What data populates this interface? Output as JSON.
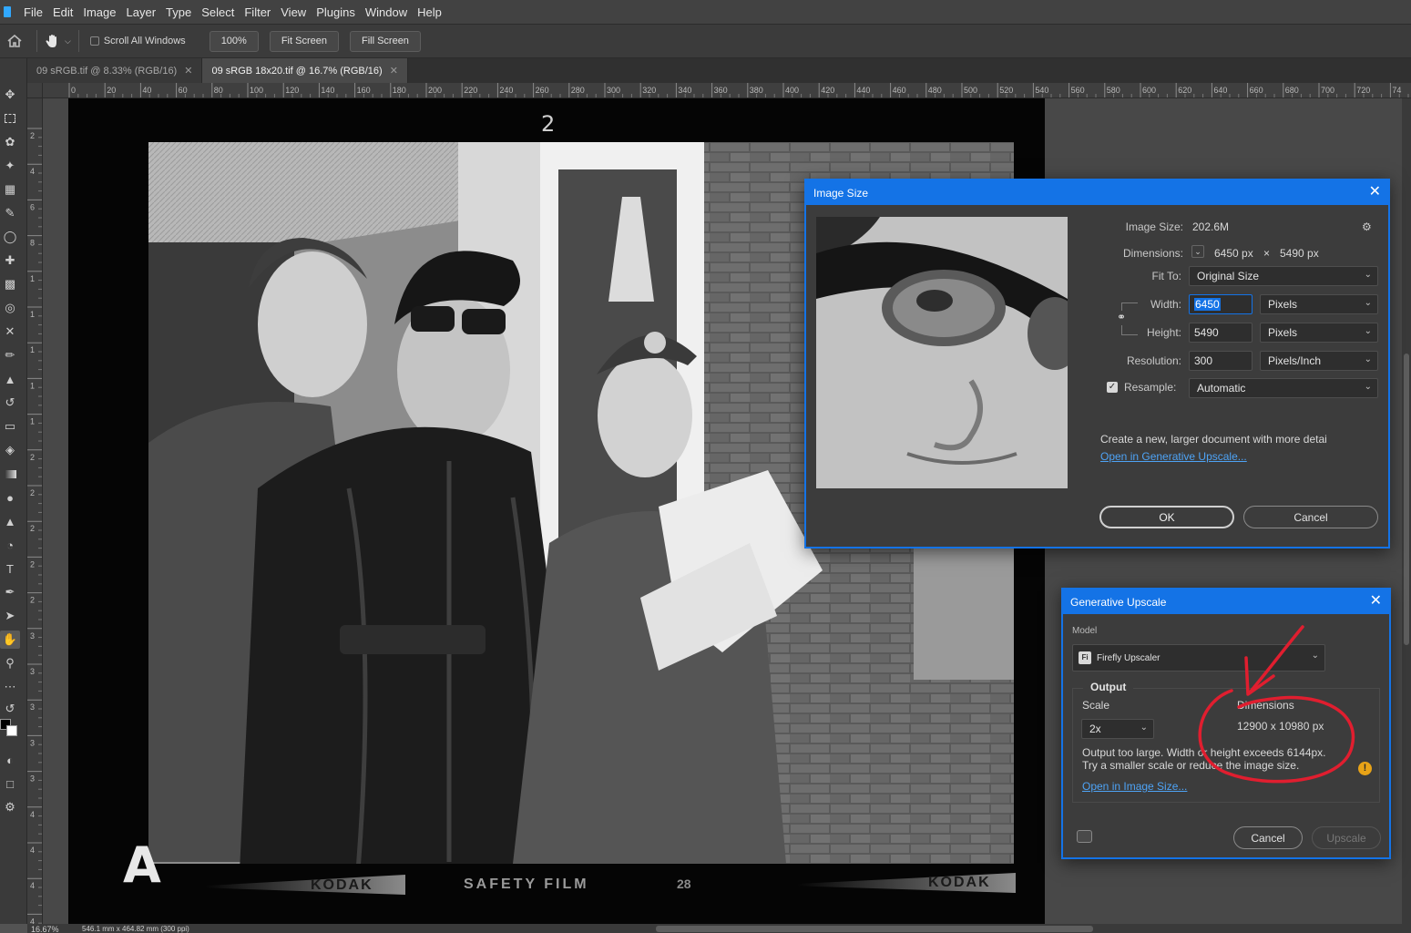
{
  "menu": [
    "File",
    "Edit",
    "Image",
    "Layer",
    "Type",
    "Select",
    "Filter",
    "View",
    "Plugins",
    "Window",
    "Help"
  ],
  "options_bar": {
    "scroll_all_windows": "Scroll All Windows",
    "zoom_btn": "100%",
    "fit_screen": "Fit Screen",
    "fill_screen": "Fill Screen"
  },
  "tabs": [
    {
      "label": "09 sRGB.tif @ 8.33% (RGB/16)"
    },
    {
      "label": "09 sRGB 18x20.tif @ 16.7% (RGB/16)"
    }
  ],
  "ruler_h": [
    "0",
    "20",
    "40",
    "60",
    "80",
    "100",
    "120",
    "140",
    "160",
    "180",
    "200",
    "220",
    "240",
    "260",
    "280",
    "300",
    "320",
    "340",
    "360",
    "380",
    "400",
    "420",
    "440",
    "460",
    "480",
    "500",
    "520",
    "540",
    "560",
    "580",
    "600",
    "620",
    "640",
    "660",
    "680",
    "700",
    "720",
    "74"
  ],
  "ruler_v": [
    "2",
    "4",
    "6",
    "8",
    "1",
    "1",
    "1",
    "1",
    "1",
    "2",
    "2",
    "2",
    "2",
    "2",
    "3",
    "3",
    "3",
    "3",
    "3",
    "4",
    "4",
    "4",
    "4",
    "4"
  ],
  "film": {
    "frame_number": "2",
    "edge_text": [
      "KODAK",
      "SAFETY FILM",
      "28",
      "KODAK"
    ],
    "edge_letter": "A"
  },
  "image_size_dialog": {
    "title": "Image Size",
    "image_size_label": "Image Size:",
    "image_size_value": "202.6M",
    "dimensions_label": "Dimensions:",
    "dim_w": "6450 px",
    "dim_x": "×",
    "dim_h": "5490 px",
    "fit_to_label": "Fit To:",
    "fit_to_value": "Original Size",
    "width_label": "Width:",
    "width_value": "6450",
    "width_unit": "Pixels",
    "height_label": "Height:",
    "height_value": "5490",
    "height_unit": "Pixels",
    "resolution_label": "Resolution:",
    "resolution_value": "300",
    "resolution_unit": "Pixels/Inch",
    "resample_label": "Resample:",
    "resample_value": "Automatic",
    "info_text": "Create a new, larger document with more detai",
    "upscale_link": "Open in Generative Upscale...",
    "ok": "OK",
    "cancel": "Cancel"
  },
  "gen_upscale_dialog": {
    "title": "Generative Upscale",
    "model_label": "Model",
    "model_value": "Firefly Upscaler",
    "model_icon": "Fi",
    "output_label": "Output",
    "scale_label": "Scale",
    "scale_value": "2x",
    "dimensions_label": "Dimensions",
    "dimensions_value": "12900 x 10980 px",
    "warning_line1": "Output too large. Width or height exceeds 6144px.",
    "warning_line2": "Try a smaller scale or reduce the image size.",
    "image_size_link": "Open in Image Size...",
    "cancel": "Cancel",
    "upscale": "Upscale"
  },
  "status": {
    "zoom": "16.67%",
    "doc_size": "546.1 mm x 464.82 mm (300 ppi)"
  },
  "colors": {
    "accent": "#1473e6",
    "annotation": "#e01e2f",
    "warning": "#e8a317"
  }
}
